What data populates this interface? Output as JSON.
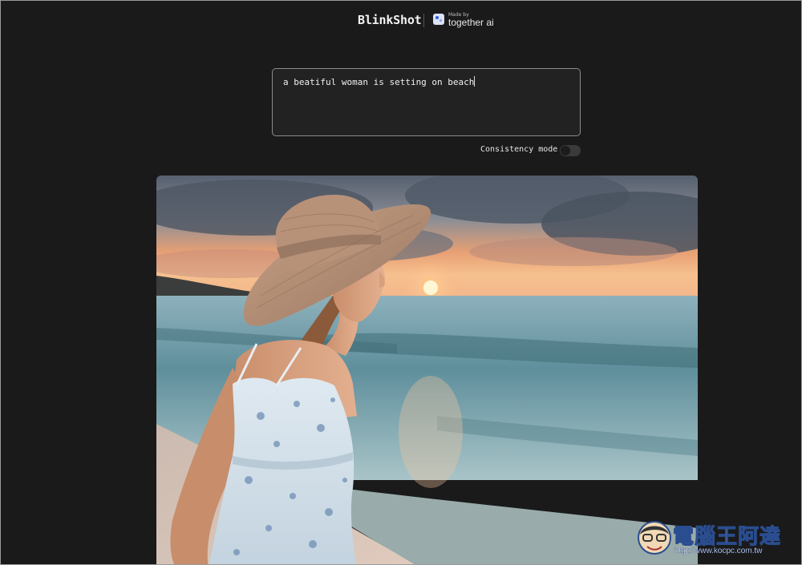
{
  "header": {
    "brand": "BlinkShot",
    "partner_prefix": "Made by",
    "partner_name": "together ai"
  },
  "prompt": {
    "value": "a beatiful woman is setting on beach"
  },
  "consistency": {
    "label": "Consistency mode",
    "enabled": false
  },
  "image": {
    "icon": "generated-image"
  },
  "watermark": {
    "text": "電腦王阿達",
    "url": "http://www.kocpc.com.tw"
  },
  "colors": {
    "background": "#1a1a1a",
    "input_bg": "#222222",
    "input_border": "#8c8c8c",
    "text": "#f0f0f0"
  }
}
